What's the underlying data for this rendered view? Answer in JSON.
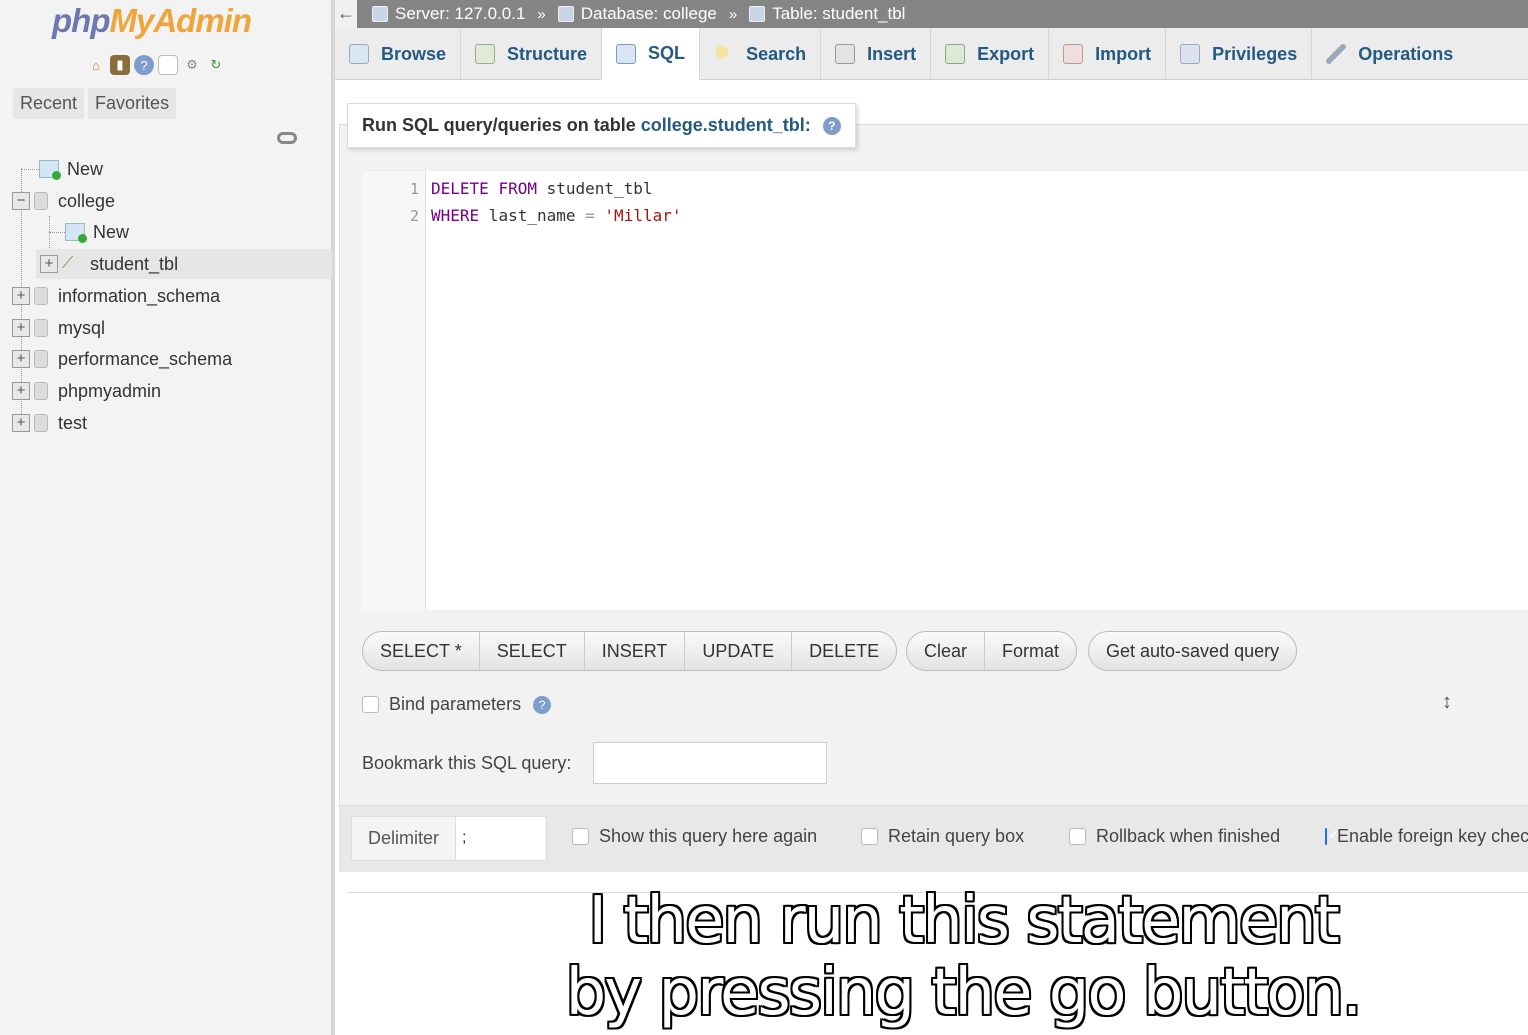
{
  "nav": {
    "logo_php": "php",
    "logo_myadmin": "MyAdmin",
    "tabs": [
      "Recent",
      "Favorites"
    ],
    "tree": [
      {
        "label": "New",
        "level": 0,
        "type": "new"
      },
      {
        "label": "college",
        "level": 0,
        "type": "db",
        "expanded": true
      },
      {
        "label": "New",
        "level": 1,
        "type": "new"
      },
      {
        "label": "student_tbl",
        "level": 1,
        "type": "table",
        "selected": true
      },
      {
        "label": "information_schema",
        "level": 0,
        "type": "db"
      },
      {
        "label": "mysql",
        "level": 0,
        "type": "db"
      },
      {
        "label": "performance_schema",
        "level": 0,
        "type": "db"
      },
      {
        "label": "phpmyadmin",
        "level": 0,
        "type": "db"
      },
      {
        "label": "test",
        "level": 0,
        "type": "db"
      }
    ]
  },
  "breadcrumb": {
    "server": "Server: 127.0.0.1",
    "database": "Database: college",
    "table": "Table: student_tbl",
    "separator": "»"
  },
  "tabs": [
    {
      "label": "Browse",
      "icon": "browse-icon"
    },
    {
      "label": "Structure",
      "icon": "structure-icon"
    },
    {
      "label": "SQL",
      "icon": "sql-icon",
      "active": true
    },
    {
      "label": "Search",
      "icon": "search-icon"
    },
    {
      "label": "Insert",
      "icon": "insert-icon"
    },
    {
      "label": "Export",
      "icon": "export-icon"
    },
    {
      "label": "Import",
      "icon": "import-icon"
    },
    {
      "label": "Privileges",
      "icon": "privileges-icon"
    },
    {
      "label": "Operations",
      "icon": "operations-icon"
    }
  ],
  "query_box": {
    "legend_prefix": "Run SQL query/queries on table",
    "legend_table": "college.student_tbl:",
    "lines": [
      {
        "no": "1",
        "tokens": [
          {
            "t": "DELETE",
            "c": "kw"
          },
          {
            "t": " ",
            "c": ""
          },
          {
            "t": "FROM",
            "c": "kw"
          },
          {
            "t": " student_tbl",
            "c": ""
          }
        ]
      },
      {
        "no": "2",
        "tokens": [
          {
            "t": "WHERE",
            "c": "kw"
          },
          {
            "t": " last_name ",
            "c": ""
          },
          {
            "t": "=",
            "c": "op"
          },
          {
            "t": " ",
            "c": ""
          },
          {
            "t": "'Millar'",
            "c": "str"
          }
        ]
      }
    ]
  },
  "buttons": {
    "group1": [
      "SELECT *",
      "SELECT",
      "INSERT",
      "UPDATE",
      "DELETE"
    ],
    "group2": [
      "Clear",
      "Format"
    ],
    "group3": [
      "Get auto-saved query"
    ]
  },
  "bind_parameters": {
    "label": "Bind parameters",
    "checked": false
  },
  "bookmark": {
    "label": "Bookmark this SQL query:",
    "value": ""
  },
  "options": {
    "delimiter_label": "Delimiter",
    "delimiter_value": ";",
    "show_query": {
      "label": "Show this query here again",
      "checked": false
    },
    "retain_box": {
      "label": "Retain query box",
      "checked": false
    },
    "rollback": {
      "label": "Rollback when finished",
      "checked": false
    },
    "foreign_key": {
      "label": "Enable foreign key checks",
      "checked": true
    }
  },
  "subtitle": {
    "line1": "I then run this statement",
    "line2": "by pressing the go button."
  }
}
